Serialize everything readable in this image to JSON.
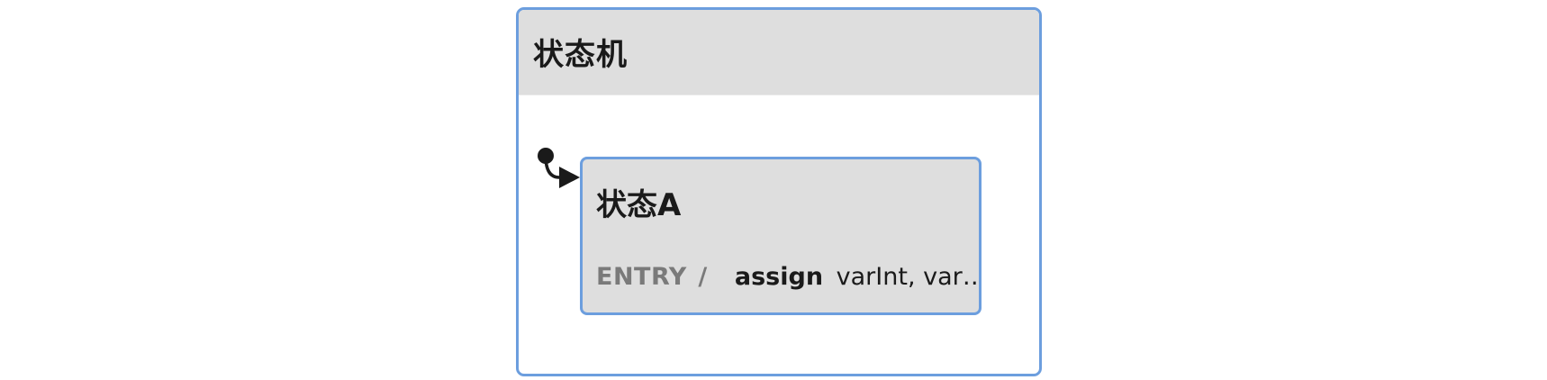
{
  "machine": {
    "title": "状态机"
  },
  "state": {
    "title": "状态A",
    "entry_label": "ENTRY",
    "entry_slash": "/",
    "entry_action": "assign",
    "entry_args": "varInt, var…"
  },
  "colors": {
    "border": "#6c9ede",
    "header_bg": "#dedede",
    "text": "#1a1a1a",
    "muted_text": "#7a7a7a"
  },
  "icons": {
    "initial_marker": "initial-state-dot-icon",
    "transition_arrow": "arrow-right-icon"
  }
}
